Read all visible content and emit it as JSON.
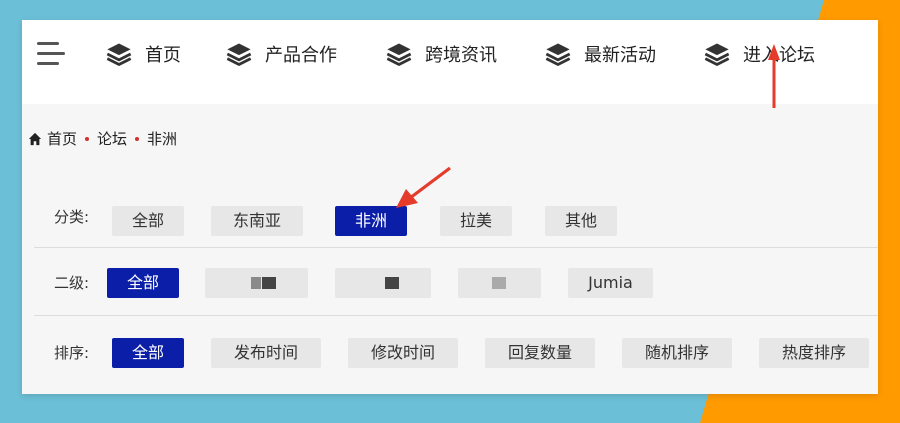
{
  "nav": {
    "items": [
      {
        "label": "首页",
        "icon": "layers-icon"
      },
      {
        "label": "产品合作",
        "icon": "layers-icon"
      },
      {
        "label": "跨境资讯",
        "icon": "layers-icon"
      },
      {
        "label": "最新活动",
        "icon": "layers-icon"
      },
      {
        "label": "进入论坛",
        "icon": "layers-icon"
      }
    ]
  },
  "breadcrumb": {
    "home": "首页",
    "items": [
      "论坛",
      "非洲"
    ]
  },
  "filters": {
    "category": {
      "label": "分类:",
      "options": [
        "全部",
        "东南亚",
        "非洲",
        "拉美",
        "其他"
      ],
      "selected": "非洲"
    },
    "secondary": {
      "label": "二级:",
      "options": [
        "全部",
        "",
        "",
        "",
        "Jumia"
      ],
      "selected": "全部"
    },
    "sort": {
      "label": "排序:",
      "options": [
        "全部",
        "发布时间",
        "修改时间",
        "回复数量",
        "随机排序",
        "热度排序"
      ],
      "selected": "全部"
    }
  },
  "colors": {
    "active_chip": "#0a1ea8",
    "chip_bg": "#e7e7e7",
    "annotation_arrow": "#e53b2a",
    "background_left": "#6bbfd6",
    "background_right": "#ff9a00"
  }
}
